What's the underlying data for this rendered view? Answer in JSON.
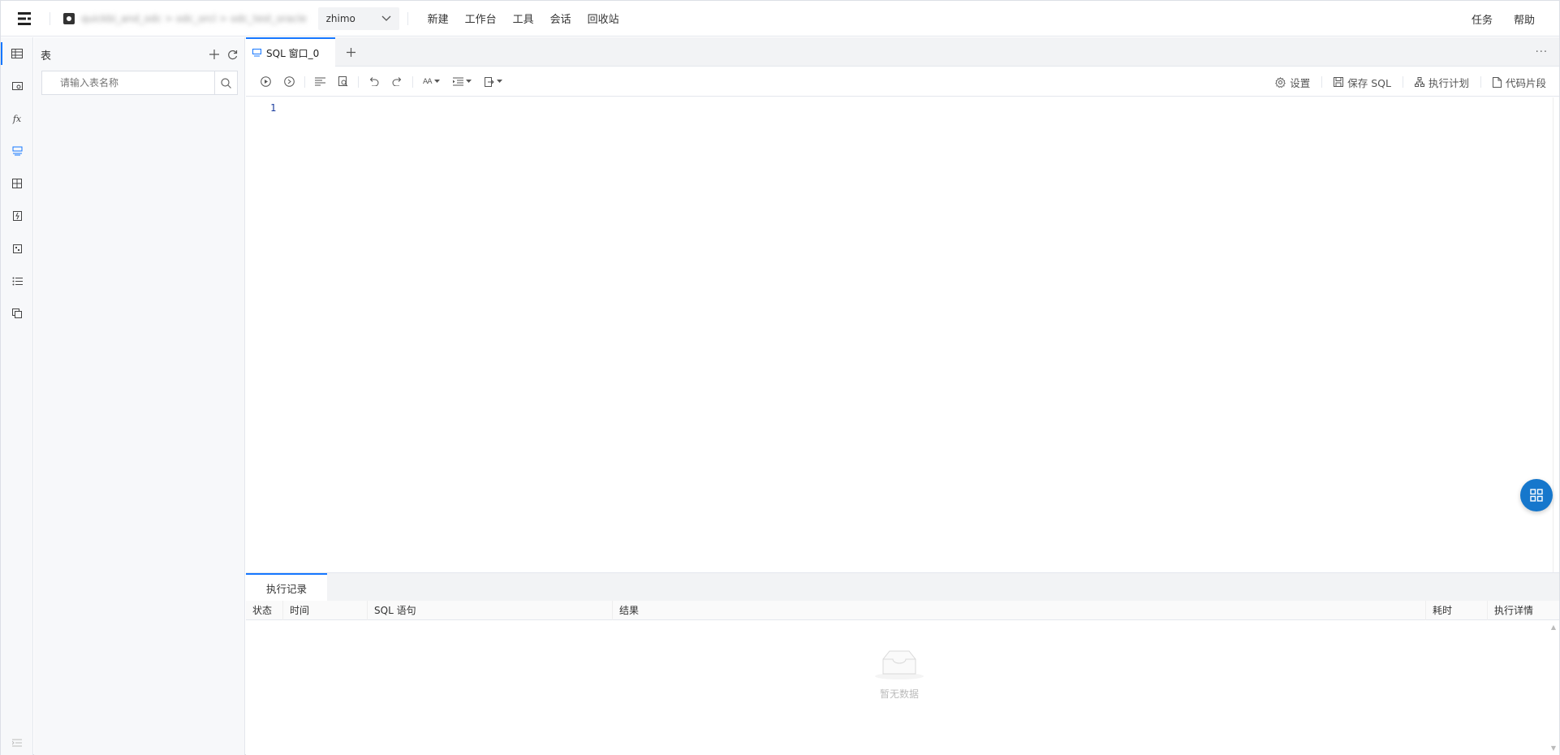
{
  "topbar": {
    "connection_path": "quickbi_and_odc > odc_orcl > odc_test_oracle",
    "database": "zhimo",
    "menu": [
      "新建",
      "工作台",
      "工具",
      "会话",
      "回收站"
    ],
    "right": [
      "任务",
      "帮助"
    ]
  },
  "table_panel": {
    "title": "表",
    "search_placeholder": "请输入表名称"
  },
  "tabs": {
    "active": "SQL 窗口_0"
  },
  "toolbar": {
    "settings": "设置",
    "save_sql": "保存 SQL",
    "exec_plan": "执行计划",
    "snippets": "代码片段"
  },
  "editor": {
    "line_number": "1"
  },
  "results": {
    "tab": "执行记录",
    "columns": [
      "状态",
      "时间",
      "SQL 语句",
      "结果",
      "耗时",
      "执行详情"
    ],
    "empty_text": "暂无数据"
  },
  "colors": {
    "accent": "#1677ff",
    "fab": "#1677cc"
  }
}
